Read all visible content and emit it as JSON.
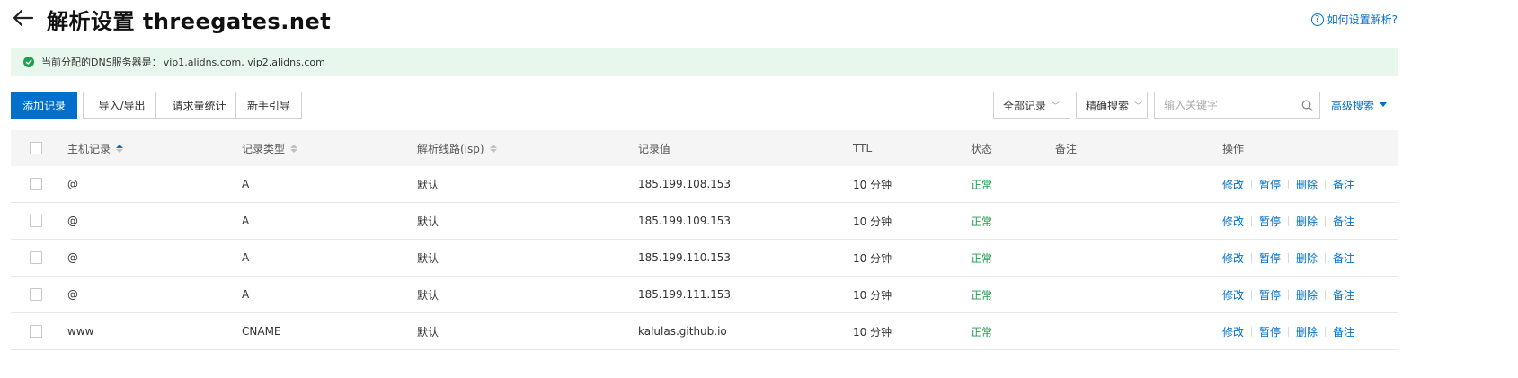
{
  "header": {
    "title": "解析设置 threegates.net",
    "help_label": "如何设置解析?",
    "help_icon": "question-circle-icon"
  },
  "banner": {
    "prefix": "当前分配的DNS服务器是：",
    "servers": "vip1.alidns.com, vip2.alidns.com",
    "icon": "check-circle-icon",
    "color": "#1e9e4f"
  },
  "toolbar": {
    "add_label": "添加记录",
    "import_label": "导入/导出",
    "stats_label": "请求量统计",
    "guide_label": "新手引导",
    "filter_all": "全部记录",
    "filter_exact": "精确搜索",
    "search_placeholder": "输入关键字",
    "advanced_label": "高级搜索",
    "accent": "#0070cc"
  },
  "table": {
    "headers": {
      "host": "主机记录",
      "type": "记录类型",
      "line": "解析线路(isp)",
      "value": "记录值",
      "ttl": "TTL",
      "status": "状态",
      "remark": "备注",
      "ops": "操作"
    },
    "op_labels": {
      "edit": "修改",
      "pause": "暂停",
      "delete": "删除",
      "remark": "备注"
    },
    "rows": [
      {
        "host": "@",
        "type": "A",
        "line": "默认",
        "value": "185.199.108.153",
        "ttl": "10 分钟",
        "status": "正常",
        "remark": ""
      },
      {
        "host": "@",
        "type": "A",
        "line": "默认",
        "value": "185.199.109.153",
        "ttl": "10 分钟",
        "status": "正常",
        "remark": ""
      },
      {
        "host": "@",
        "type": "A",
        "line": "默认",
        "value": "185.199.110.153",
        "ttl": "10 分钟",
        "status": "正常",
        "remark": ""
      },
      {
        "host": "@",
        "type": "A",
        "line": "默认",
        "value": "185.199.111.153",
        "ttl": "10 分钟",
        "status": "正常",
        "remark": ""
      },
      {
        "host": "www",
        "type": "CNAME",
        "line": "默认",
        "value": "kalulas.github.io",
        "ttl": "10 分钟",
        "status": "正常",
        "remark": ""
      }
    ]
  }
}
